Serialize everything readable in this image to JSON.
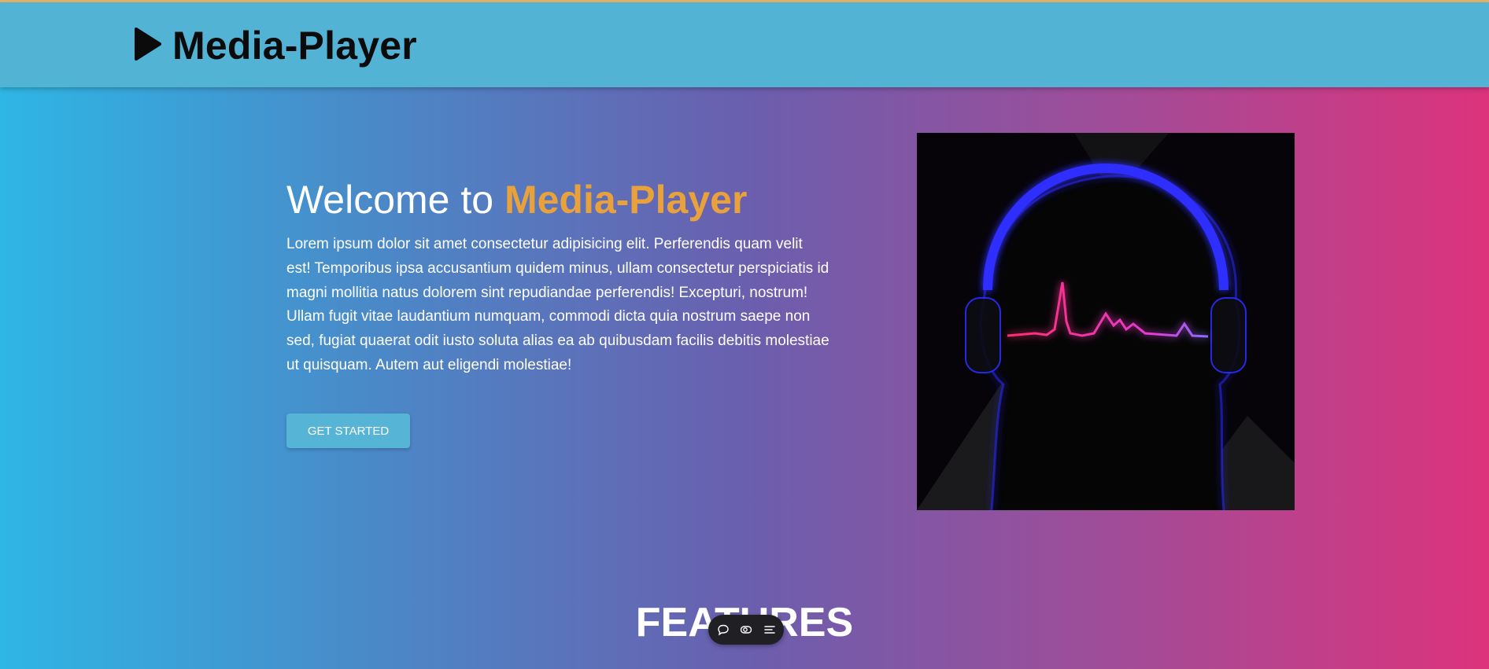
{
  "header": {
    "logo_icon": "play-icon",
    "brand": "Media-Player"
  },
  "hero": {
    "title_prefix": "Welcome to ",
    "title_accent": "Media-Player",
    "description": "Lorem ipsum dolor sit amet consectetur adipisicing elit. Perferendis quam velit est! Temporibus ipsa accusantium quidem minus, ullam consectetur perspiciatis id magni mollitia natus dolorem sint repudiandae perferendis! Excepturi, nostrum! Ullam fugit vitae laudantium numquam, commodi dicta quia nostrum saepe non sed, fugiat quaerat odit iusto soluta alias ea ab quibusdam facilis debitis molestiae ut quisquam. Autem aut eligendi molestiae!",
    "cta_label": "GET STARTED",
    "image_icon": "headphones-waveform-illustration"
  },
  "features": {
    "title": "FEATURES"
  },
  "floating_toolbar": {
    "items": [
      "chat-bubble-icon",
      "toggle-icon",
      "menu-list-icon"
    ]
  },
  "colors": {
    "header_bg": "#52b3d5",
    "accent": "#e9a23b",
    "gradient_start": "#2eb6e4",
    "gradient_end": "#dc337c",
    "button_bg": "#56b4d6"
  }
}
